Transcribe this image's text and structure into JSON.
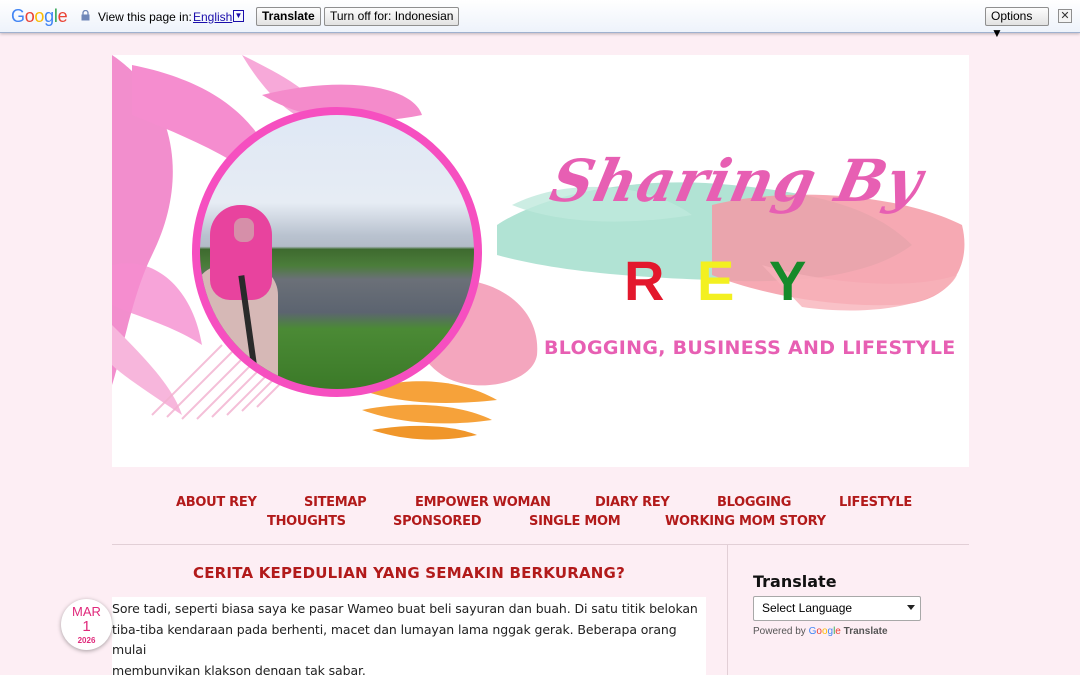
{
  "translate_bar": {
    "logo": [
      "G",
      "o",
      "o",
      "g",
      "l",
      "e"
    ],
    "view_label": "View this page in:",
    "language": "English",
    "translate_button": "Translate",
    "turn_off_button": "Turn off for: Indonesian",
    "options_button": "Options ▼",
    "close_glyph": "✕"
  },
  "header": {
    "title_script": "Sharing By",
    "title_name_letters": [
      "R",
      "E",
      "Y"
    ],
    "tagline": "BLOGGING, BUSINESS AND LIFESTYLE",
    "colors": {
      "pink": "#e75fb3",
      "red": "#e3182d",
      "yellow": "#f3f020",
      "green": "#168a2a",
      "mint": "#a8e0cf",
      "orange": "#f6a23a"
    }
  },
  "nav": {
    "items": [
      "ABOUT REY",
      "SITEMAP",
      "EMPOWER WOMAN",
      "DIARY REY",
      "BLOGGING",
      "LIFESTYLE",
      "THOUGHTS",
      "SPONSORED",
      "SINGLE MOM",
      "WORKING MOM STORY"
    ]
  },
  "post": {
    "title": "CERITA KEPEDULIAN YANG SEMAKIN BERKURANG?",
    "date": {
      "month": "MAR",
      "day": "1",
      "year": "2026"
    },
    "body_lines": [
      "Sore tadi, seperti biasa saya ke pasar Wameo buat beli sayuran dan buah. Di satu titik belokan",
      "tiba-tiba kendaraan pada berhenti, macet dan lumayan lama nggak gerak. Beberapa orang mulai",
      "membunyikan klakson dengan tak sabar."
    ]
  },
  "sidebar": {
    "translate_title": "Translate",
    "select_label": "Select Language",
    "powered_by": "Powered by",
    "google": [
      "G",
      "o",
      "o",
      "g",
      "l",
      "e"
    ],
    "translate_word": "Translate"
  }
}
